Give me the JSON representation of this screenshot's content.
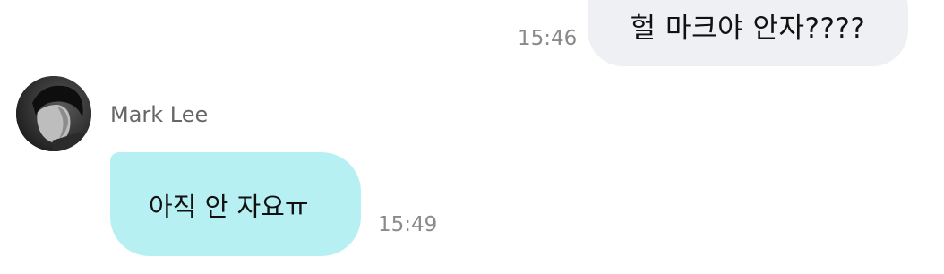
{
  "messages": [
    {
      "direction": "outgoing",
      "text": "헐 마크야 안자????",
      "time": "15:46"
    },
    {
      "direction": "incoming",
      "sender": "Mark Lee",
      "text": "아직 안 자요ㅠ",
      "time": "15:49"
    }
  ],
  "colors": {
    "outgoing_bubble": "#eff0f4",
    "incoming_bubble": "#b7f0f3",
    "timestamp": "#8a8a8a",
    "sender_name": "#666666"
  }
}
